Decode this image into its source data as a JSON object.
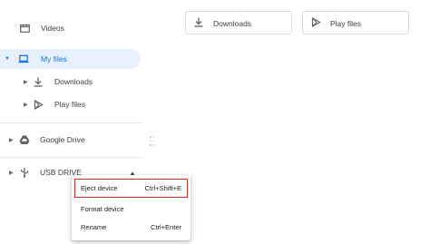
{
  "sidebar": {
    "items": [
      {
        "label": "Videos",
        "icon": "videos-icon"
      },
      {
        "label": "My files",
        "icon": "laptop-icon",
        "selected": true
      },
      {
        "label": "Downloads",
        "icon": "download-icon"
      },
      {
        "label": "Play files",
        "icon": "play-store-icon"
      },
      {
        "label": "Google Drive",
        "icon": "google-drive-icon"
      },
      {
        "label": "USB DRIVE",
        "icon": "usb-icon"
      }
    ]
  },
  "content": {
    "folders": [
      {
        "label": "Downloads",
        "icon": "download-icon"
      },
      {
        "label": "Play files",
        "icon": "play-store-icon"
      }
    ]
  },
  "context_menu": {
    "items": [
      {
        "label": "Eject device",
        "shortcut": "Ctrl+Shift+E",
        "highlighted": true
      },
      {
        "label": "Format device",
        "shortcut": ""
      },
      {
        "label": "Rename",
        "shortcut": "Ctrl+Enter"
      }
    ]
  },
  "colors": {
    "accent": "#1a73e8",
    "selected_bg": "#e8f0fe",
    "highlight_border": "#d93025",
    "text": "#3c4043"
  }
}
